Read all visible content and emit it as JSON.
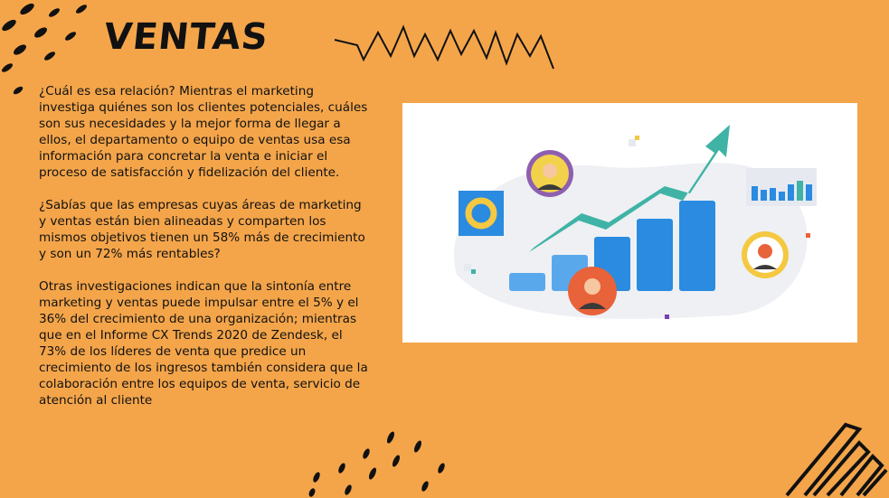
{
  "slide": {
    "title": "VENTAS",
    "paragraphs": [
      "¿Cuál es esa relación? Mientras el marketing investiga quiénes son los clientes potenciales, cuáles son sus necesidades y la mejor forma de llegar a ellos, el departamento o equipo de ventas usa esa información para concretar la venta e iniciar el proceso de satisfacción y fidelización del cliente.",
      "¿Sabías que las empresas cuyas áreas de marketing y ventas están bien alineadas y comparten los mismos objetivos tienen un 58% más de crecimiento y son un 72% más rentables?",
      "Otras investigaciones indican que la sintonía entre marketing y ventas puede impulsar entre el 5% y el 36% del crecimiento de una organización; mientras que en el Informe CX Trends 2020 de Zendesk, el 73% de los líderes de venta que predice un crecimiento de los ingresos también considera que la colaboración entre los equipos de venta, servicio de atención al cliente"
    ]
  },
  "colors": {
    "background": "#f4a54a",
    "text": "#111111",
    "bar": "#2a8be0",
    "arrow": "#3fb3a6"
  },
  "illustration": {
    "bar_levels": [
      0.2,
      0.4,
      0.6,
      0.8,
      1.0
    ]
  }
}
